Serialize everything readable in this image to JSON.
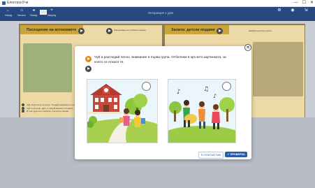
{
  "window": {
    "title": "ЕлектронУчи",
    "controls": [
      "—",
      "☐",
      "✕"
    ]
  },
  "toolbar": {
    "center_title": "Интеракция 1 урок",
    "buttons": [
      {
        "icon": "back-icon",
        "label": "Назад"
      },
      {
        "icon": "home-icon",
        "label": "Начало"
      },
      {
        "icon": "prev-icon",
        "label": "Назад"
      },
      {
        "icon": "next-icon",
        "label": "Напред"
      }
    ]
  },
  "background": {
    "left_heading": "Посещение на котокомите",
    "right_heading": "Залата: детски подами",
    "left_note": "Завършване на учебната задача",
    "right_note": "Задайте детски пърсни",
    "list_items": [
      "Чуй, кой в поле са пести. Гледай изрязаните и оцвети...",
      "Чуй и изпълни, цвят, и открий верните отговори",
      "В този урок са и първите, и вторите часове"
    ]
  },
  "modal": {
    "instruction": "Чуй и разгледай лесно, внимание и първа група. Отбележи в кръчето картинката, за която се отнася тя.",
    "close_label": "✕",
    "options": [
      {
        "name": "school-scene",
        "selected": false
      },
      {
        "name": "music-scene",
        "selected": false
      }
    ],
    "reset_label": "↻ ОПИТАЙ ПАК",
    "check_label": "✓ ПРОВЕРКА"
  }
}
